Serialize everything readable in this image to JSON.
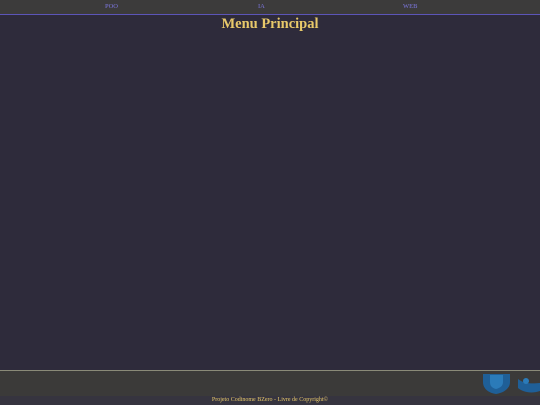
{
  "nav": {
    "items": [
      {
        "label": "POO"
      },
      {
        "label": "IA"
      },
      {
        "label": "WEB"
      }
    ]
  },
  "main": {
    "title": "Menu Principal"
  },
  "footer": {
    "text": "Projeto Codinome BZero - Livre de Copyright©",
    "logo_icon": "blue-shield-logo-icon"
  },
  "colors": {
    "background": "#2e2b3b",
    "nav_link": "#7d77e0",
    "title": "#e8c96a",
    "logo": "#1f5f97"
  }
}
